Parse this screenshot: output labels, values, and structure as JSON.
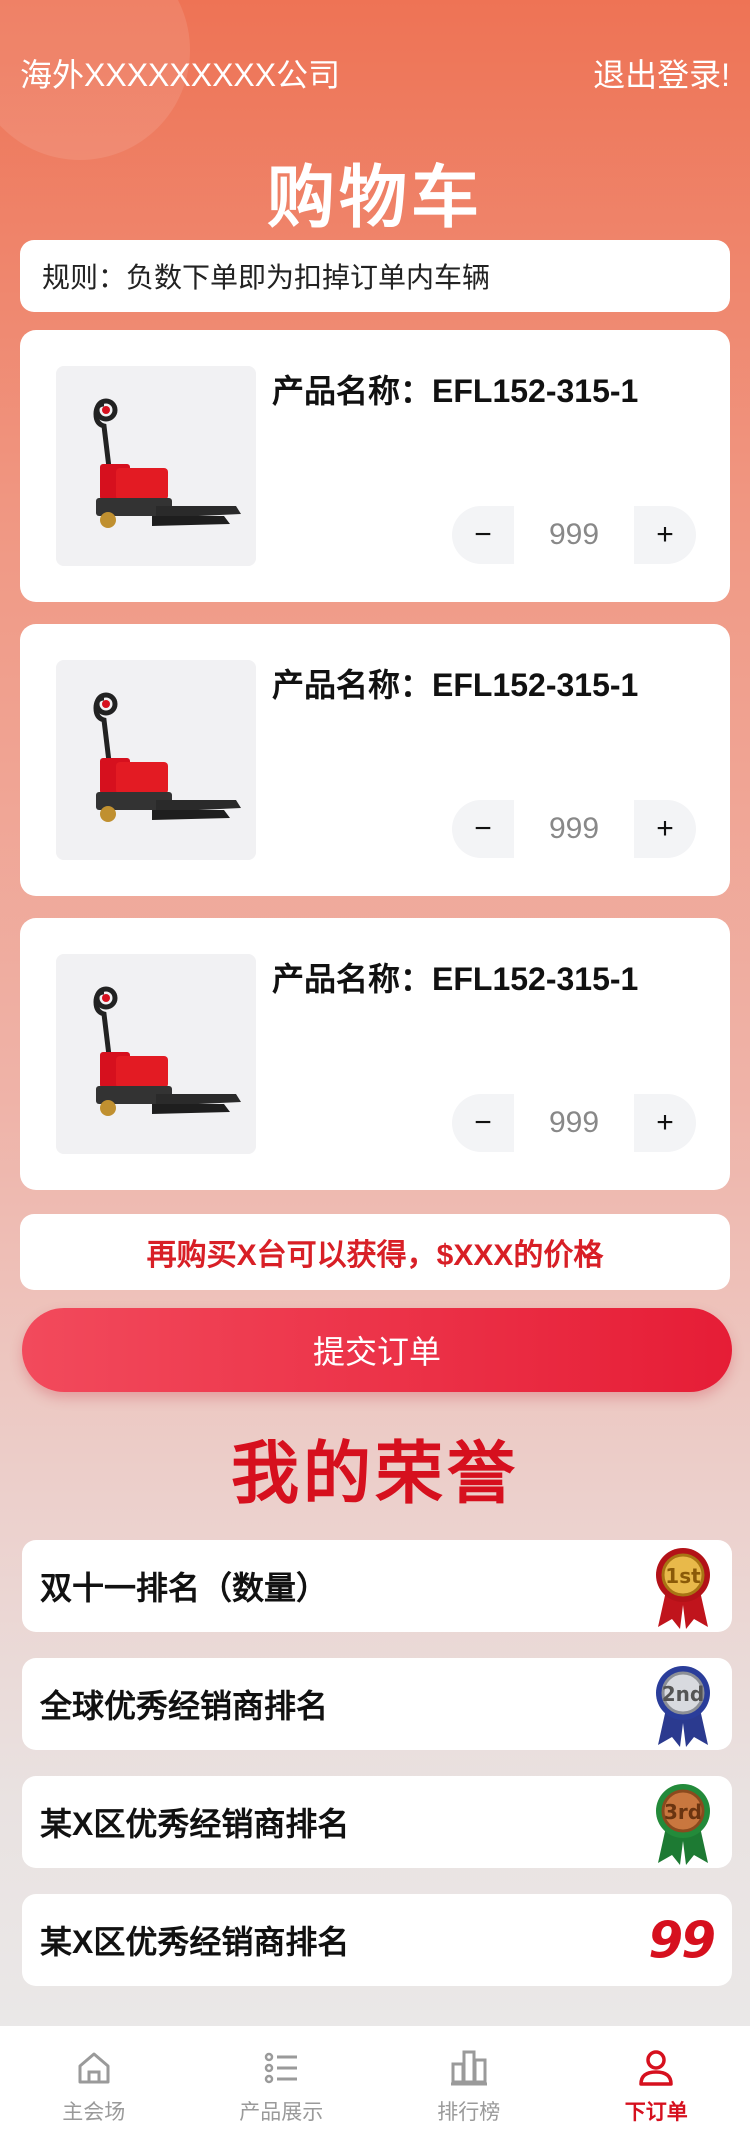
{
  "header": {
    "company": "海外XXXXXXXXX公司",
    "logout": "退出登录!"
  },
  "cart": {
    "title": "购物车",
    "rule": "规则：负数下单即为扣掉订单内车辆",
    "items": [
      {
        "name_label": "产品名称：EFL152-315-1",
        "qty": "999",
        "minus": "−",
        "plus": "+"
      },
      {
        "name_label": "产品名称：EFL152-315-1",
        "qty": "999",
        "minus": "−",
        "plus": "+"
      },
      {
        "name_label": "产品名称：EFL152-315-1",
        "qty": "999",
        "minus": "−",
        "plus": "+"
      }
    ],
    "promo": "再购买X台可以获得，$XXX的价格",
    "submit": "提交订单"
  },
  "honors": {
    "title": "我的荣誉",
    "rows": [
      {
        "label": "双十一排名（数量）",
        "medal": "gold-medal-1",
        "medal_text": "1st"
      },
      {
        "label": "全球优秀经销商排名",
        "medal": "silver-medal-2",
        "medal_text": "2nd"
      },
      {
        "label": "某X区优秀经销商排名",
        "medal": "bronze-medal-3",
        "medal_text": "3rd"
      },
      {
        "label": "某X区优秀经销商排名",
        "rank": "99"
      }
    ]
  },
  "tabbar": {
    "items": [
      {
        "label": "主会场",
        "icon": "home-icon"
      },
      {
        "label": "产品展示",
        "icon": "list-icon"
      },
      {
        "label": "排行榜",
        "icon": "ranking-icon"
      },
      {
        "label": "下订单",
        "icon": "user-icon",
        "active": true
      }
    ]
  },
  "colors": {
    "accent": "#d6101e",
    "header_gradient_top": "#ee7355",
    "submit": "#e61d36"
  }
}
